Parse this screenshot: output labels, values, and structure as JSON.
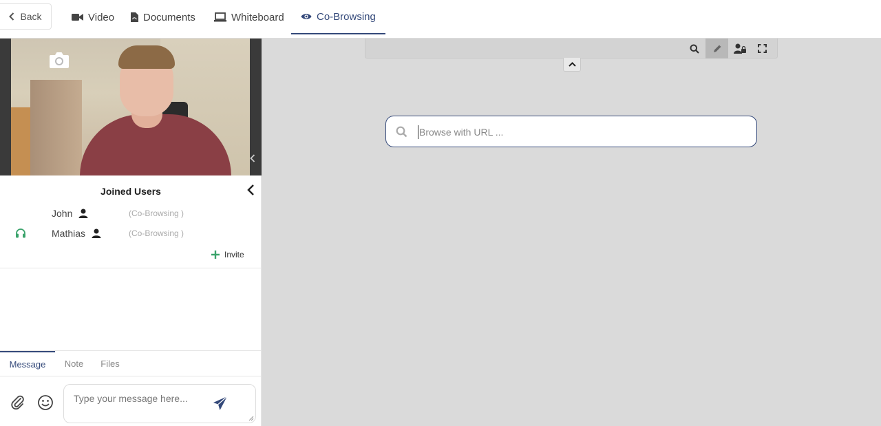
{
  "nav": {
    "back_label": "Back",
    "tabs": [
      {
        "label": "Video",
        "icon": "video-camera-icon"
      },
      {
        "label": "Documents",
        "icon": "pdf-file-icon"
      },
      {
        "label": "Whiteboard",
        "icon": "laptop-icon"
      },
      {
        "label": "Co-Browsing",
        "icon": "eye-icon"
      }
    ],
    "active_tab": "Co-Browsing"
  },
  "colors": {
    "accent": "#34497a",
    "support_icon": "#3aa36b",
    "invite_plus": "#3aa36b",
    "workspace_bg": "#dadada"
  },
  "joined_users": {
    "title": "Joined Users",
    "users": [
      {
        "name": "John",
        "status": "(Co-Browsing )"
      },
      {
        "name": "Mathias",
        "status": "(Co-Browsing )",
        "support_icon": "headset-icon"
      }
    ],
    "invite_label": "Invite"
  },
  "chat": {
    "tabs": [
      "Message",
      "Note",
      "Files"
    ],
    "active_tab": "Message",
    "placeholder": "Type your message here..."
  },
  "cobrowse": {
    "toolbar_tools": [
      "search-icon",
      "pencil-icon",
      "user-lock-icon",
      "fullscreen-icon"
    ],
    "active_tool": "pencil-icon",
    "url_placeholder": "Browse with URL ..."
  }
}
